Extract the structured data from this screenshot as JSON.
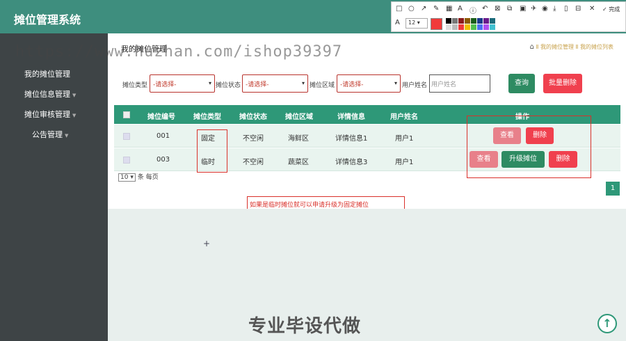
{
  "app": {
    "title": "摊位管理系统"
  },
  "sidebar": {
    "items": [
      {
        "label": "我的摊位管理"
      },
      {
        "label": "摊位信息管理"
      },
      {
        "label": "摊位审核管理"
      },
      {
        "label": "公告管理"
      }
    ]
  },
  "page": {
    "title": "我的摊位管理",
    "breadcrumb": {
      "section": "我的摊位管理",
      "sep": "Ⅱ",
      "current": "我的摊位列表"
    }
  },
  "filters": {
    "type_label": "摊位类型",
    "type_value": "-请选择-",
    "status_label": "摊位状态",
    "status_value": "-请选择-",
    "area_label": "摊位区域",
    "area_value": "-请选择-",
    "user_label": "用户姓名",
    "user_placeholder": "用户姓名",
    "query_label": "查询",
    "batch_delete_label": "批量删除"
  },
  "table": {
    "headers": [
      "摊位编号",
      "摊位类型",
      "摊位状态",
      "摊位区域",
      "详情信息",
      "用户姓名",
      "操作"
    ],
    "rows": [
      {
        "id": "001",
        "type": "固定",
        "status": "不空闲",
        "area": "海鲜区",
        "detail": "详情信息1",
        "user": "用户1",
        "actions": [
          "查看",
          "删除"
        ]
      },
      {
        "id": "003",
        "type": "临时",
        "status": "不空闲",
        "area": "蔬菜区",
        "detail": "详情信息3",
        "user": "用户1",
        "actions": [
          "查看",
          "升级摊位",
          "删除"
        ]
      }
    ]
  },
  "pagination": {
    "per_page": "10",
    "per_page_suffix": "条 每页",
    "current_page": "1"
  },
  "annotation": {
    "note": "如果是临时摊位就可以申请升级为固定摊位"
  },
  "toolbar": {
    "font_size": "12",
    "done_label": "完成"
  },
  "watermark": {
    "url": "https://www.huzhan.com/ishop39397",
    "bottom_text": "专业毕设代做"
  },
  "colors": {
    "header": "#3e8e7e",
    "sidebar": "#3e4446",
    "table_header": "#2e9878",
    "danger": "#f0404e",
    "primary": "#2e8b62",
    "annotation": "#d9302a"
  }
}
